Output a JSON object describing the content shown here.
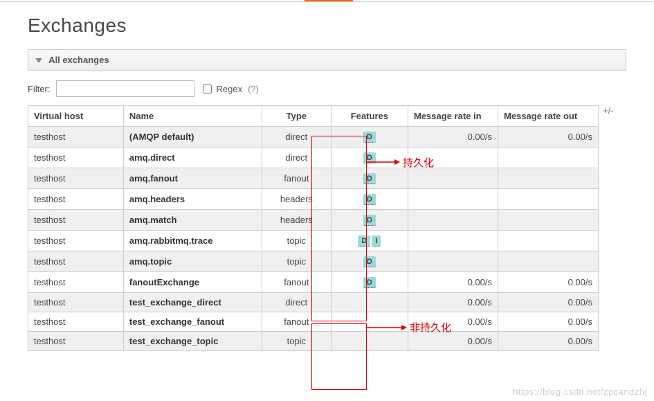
{
  "page_title": "Exchanges",
  "section_header": "All exchanges",
  "filter": {
    "label": "Filter:",
    "value": "",
    "regex_label": "Regex",
    "help": "(?)"
  },
  "columns": {
    "vhost": "Virtual host",
    "name": "Name",
    "type": "Type",
    "features": "Features",
    "rate_in": "Message rate in",
    "rate_out": "Message rate out",
    "plusminus": "+/-"
  },
  "feature_tags": {
    "D": "D",
    "I": "I"
  },
  "rows": [
    {
      "vhost": "testhost",
      "name": "(AMQP default)",
      "type": "direct",
      "features": [
        "D"
      ],
      "rate_in": "0.00/s",
      "rate_out": "0.00/s"
    },
    {
      "vhost": "testhost",
      "name": "amq.direct",
      "type": "direct",
      "features": [
        "D"
      ],
      "rate_in": "",
      "rate_out": ""
    },
    {
      "vhost": "testhost",
      "name": "amq.fanout",
      "type": "fanout",
      "features": [
        "D"
      ],
      "rate_in": "",
      "rate_out": ""
    },
    {
      "vhost": "testhost",
      "name": "amq.headers",
      "type": "headers",
      "features": [
        "D"
      ],
      "rate_in": "",
      "rate_out": ""
    },
    {
      "vhost": "testhost",
      "name": "amq.match",
      "type": "headers",
      "features": [
        "D"
      ],
      "rate_in": "",
      "rate_out": ""
    },
    {
      "vhost": "testhost",
      "name": "amq.rabbitmq.trace",
      "type": "topic",
      "features": [
        "D",
        "I"
      ],
      "rate_in": "",
      "rate_out": ""
    },
    {
      "vhost": "testhost",
      "name": "amq.topic",
      "type": "topic",
      "features": [
        "D"
      ],
      "rate_in": "",
      "rate_out": ""
    },
    {
      "vhost": "testhost",
      "name": "fanoutExchange",
      "type": "fanout",
      "features": [
        "D"
      ],
      "rate_in": "0.00/s",
      "rate_out": "0.00/s"
    },
    {
      "vhost": "testhost",
      "name": "test_exchange_direct",
      "type": "direct",
      "features": [],
      "rate_in": "0.00/s",
      "rate_out": "0.00/s"
    },
    {
      "vhost": "testhost",
      "name": "test_exchange_fanout",
      "type": "fanout",
      "features": [],
      "rate_in": "0.00/s",
      "rate_out": "0.00/s"
    },
    {
      "vhost": "testhost",
      "name": "test_exchange_topic",
      "type": "topic",
      "features": [],
      "rate_in": "0.00/s",
      "rate_out": "0.00/s"
    }
  ],
  "annotations": {
    "durable": "持久化",
    "nondurable": "非持久化"
  },
  "watermark": "https://blog.csdn.net/zpcandzhj"
}
